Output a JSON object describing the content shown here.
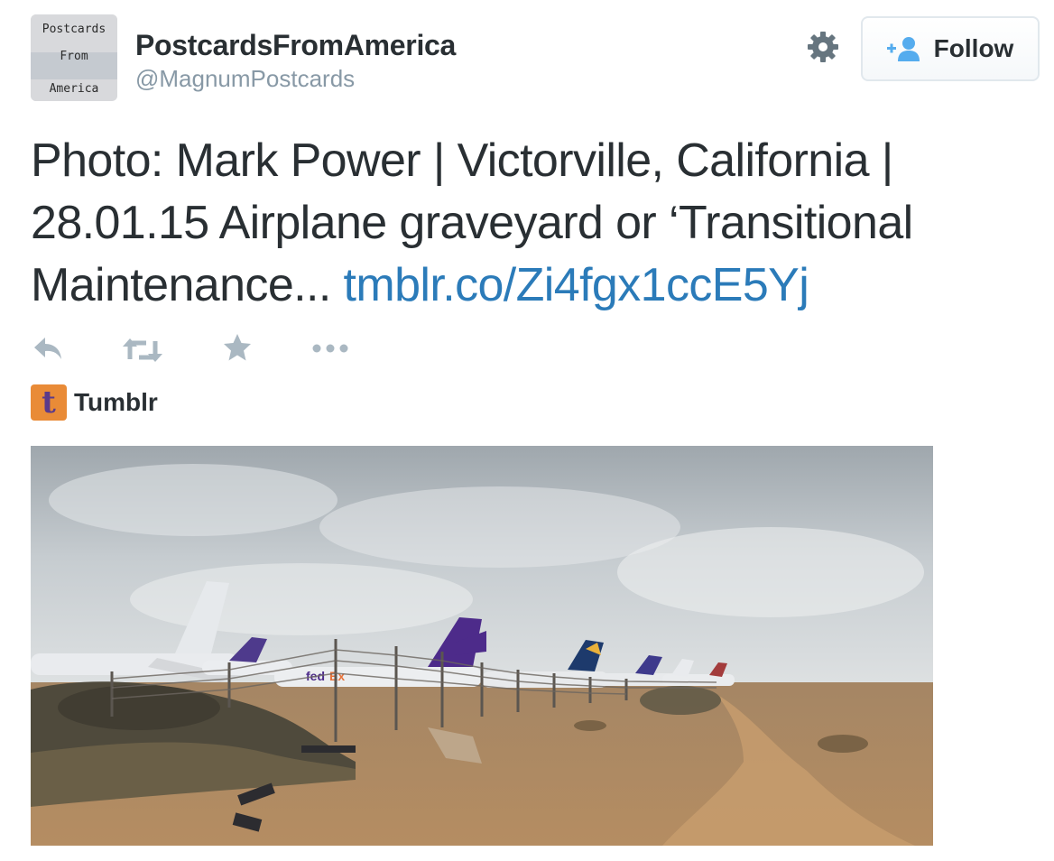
{
  "author": {
    "display_name": "PostcardsFromAmerica",
    "handle": "@MagnumPostcards",
    "avatar_text": [
      "Postcards",
      "From",
      "America"
    ]
  },
  "follow_button": {
    "label": "Follow",
    "icon": "add-user-icon"
  },
  "settings": {
    "icon": "gear-icon"
  },
  "tweet": {
    "text": "Photo: Mark Power  |  Victorville, California  |  28.01.15 Airplane graveyard or ‘Transitional Maintenance... ",
    "link": "tmblr.co/Zi4fgx1ccE5Yj"
  },
  "actions": [
    {
      "name": "reply",
      "icon": "reply-icon"
    },
    {
      "name": "retweet",
      "icon": "retweet-icon"
    },
    {
      "name": "favorite",
      "icon": "star-icon"
    },
    {
      "name": "more",
      "icon": "more-icon"
    }
  ],
  "source": {
    "name": "Tumblr",
    "logo_letter": "t",
    "logo_color": "#e98b37"
  },
  "photo": {
    "description_icon": "photo-airplane-graveyard"
  },
  "colors": {
    "text": "#292f33",
    "secondary": "#8899a6",
    "link": "#2b7bb9",
    "action_icon": "#aab8c2",
    "follow_icon": "#55acee"
  }
}
